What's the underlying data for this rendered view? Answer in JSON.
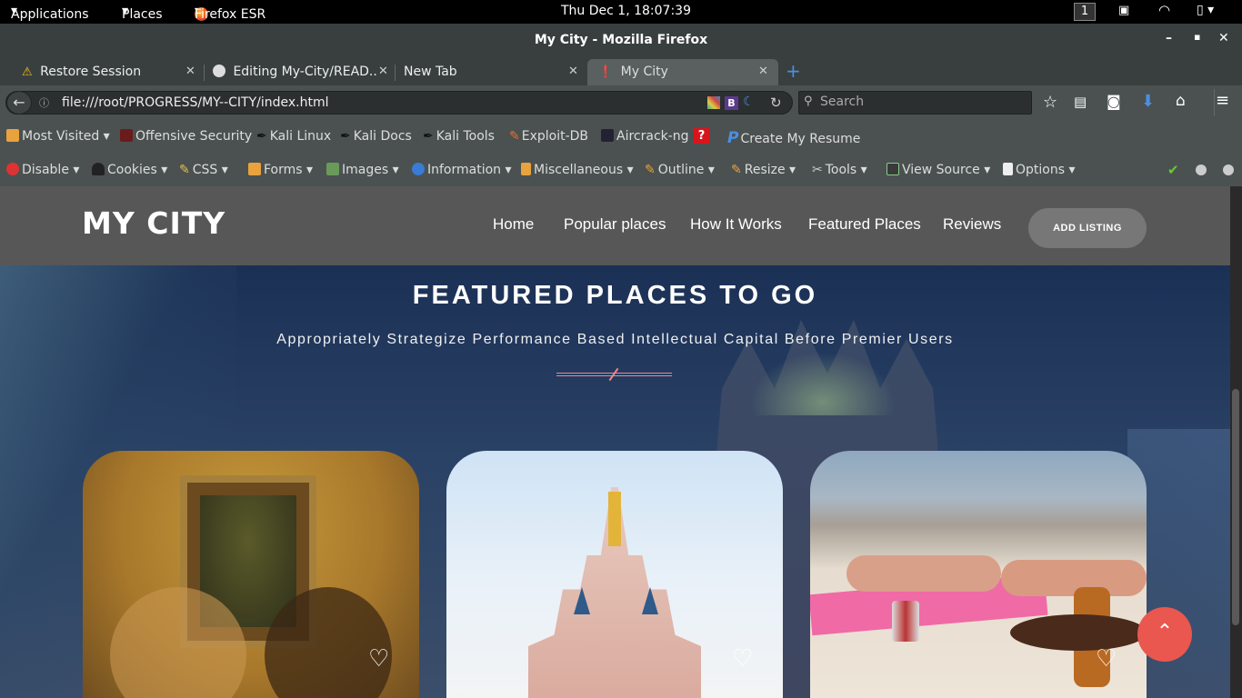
{
  "system_bar": {
    "applications": "Applications",
    "places": "Places",
    "firefox": "Firefox ESR",
    "clock": "Thu Dec  1, 18:07:39",
    "workspace": "1"
  },
  "window": {
    "title": "My City - Mozilla Firefox"
  },
  "tabs": [
    {
      "label": "Restore Session"
    },
    {
      "label": "Editing My-City/READ..."
    },
    {
      "label": "New Tab"
    },
    {
      "label": "My City"
    }
  ],
  "url_bar": {
    "url": "file:///root/PROGRESS/MY--CITY/index.html"
  },
  "search": {
    "placeholder": "Search"
  },
  "bookmarks": [
    {
      "label": "Most Visited ▾"
    },
    {
      "label": "Offensive Security"
    },
    {
      "label": "Kali Linux"
    },
    {
      "label": "Kali Docs"
    },
    {
      "label": "Kali Tools"
    },
    {
      "label": "Exploit-DB"
    },
    {
      "label": "Aircrack-ng"
    },
    {
      "label": "Create My Resume"
    }
  ],
  "dev_toolbar": [
    {
      "label": "Disable ▾"
    },
    {
      "label": "Cookies ▾"
    },
    {
      "label": "CSS ▾"
    },
    {
      "label": "Forms ▾"
    },
    {
      "label": "Images ▾"
    },
    {
      "label": "Information ▾"
    },
    {
      "label": "Miscellaneous ▾"
    },
    {
      "label": "Outline ▾"
    },
    {
      "label": "Resize ▾"
    },
    {
      "label": "Tools ▾"
    },
    {
      "label": "View Source ▾"
    },
    {
      "label": "Options ▾"
    }
  ],
  "site": {
    "logo": "MY CITY",
    "nav": [
      {
        "label": "Home"
      },
      {
        "label": "Popular places"
      },
      {
        "label": "How It Works"
      },
      {
        "label": "Featured Places"
      },
      {
        "label": "Reviews"
      }
    ],
    "cta": "ADD LISTING",
    "section_title": "FEATURED PLACES TO GO",
    "section_subtitle": "Appropriately Strategize Performance Based Intellectual Capital Before Premier Users"
  },
  "colors": {
    "accent_red": "#e9574f",
    "nav_bg": "#575757"
  }
}
